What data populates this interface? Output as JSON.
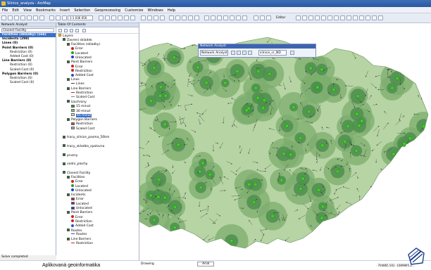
{
  "app": {
    "title": "Silnice_analyza - ArcMap"
  },
  "menu": [
    "File",
    "Edit",
    "View",
    "Bookmarks",
    "Insert",
    "Selection",
    "Geoprocessing",
    "Customize",
    "Windows",
    "Help"
  ],
  "toolbar": {
    "scale": "1:1 036 056",
    "editor_label": "Editor"
  },
  "network_analyst": {
    "title": "Network Analyst",
    "selected": "Closest Facility",
    "items": [
      {
        "label": "Facilities (skladky) (166)",
        "cls": "bold hl"
      },
      {
        "label": "Incidents (298)",
        "cls": "bold"
      },
      {
        "label": "Lines (0)",
        "cls": "bold"
      },
      {
        "label": "Point Barriers (0)",
        "cls": "bold"
      },
      {
        "label": "Restriction (0)",
        "cls": "sub"
      },
      {
        "label": "Added Cost (0)",
        "cls": "sub"
      },
      {
        "label": "Line Barriers (0)",
        "cls": "bold"
      },
      {
        "label": "Restriction (0)",
        "cls": "sub"
      },
      {
        "label": "Scaled Cost (0)",
        "cls": "sub"
      },
      {
        "label": "Polygon Barriers (0)",
        "cls": "bold"
      },
      {
        "label": "Restriction (0)",
        "cls": "sub"
      },
      {
        "label": "Scaled Cost (0)",
        "cls": "sub"
      }
    ],
    "status": "Solve completed"
  },
  "toc": {
    "title": "Table Of Contents",
    "rows": [
      {
        "text": "Layers",
        "indent": 0,
        "kind": "folder"
      },
      {
        "text": "Zavreni skladek",
        "indent": 1,
        "kind": "cb"
      },
      {
        "text": "Facilities (skladky)",
        "indent": 2,
        "kind": "cb"
      },
      {
        "text": "Error",
        "indent": 3,
        "kind": "dot",
        "color": "#d02020"
      },
      {
        "text": "Located",
        "indent": 3,
        "kind": "dot",
        "color": "#20a020"
      },
      {
        "text": "Unlocated",
        "indent": 3,
        "kind": "dot",
        "color": "#2040d0"
      },
      {
        "text": "Point Barriers",
        "indent": 2,
        "kind": "cb"
      },
      {
        "text": "Error",
        "indent": 3,
        "kind": "dot",
        "color": "#d02020"
      },
      {
        "text": "Restriction",
        "indent": 3,
        "kind": "dot",
        "color": "#d02020"
      },
      {
        "text": "Added Cost",
        "indent": 3,
        "kind": "dot",
        "color": "#3050c0"
      },
      {
        "text": "Lines",
        "indent": 2,
        "kind": "cb"
      },
      {
        "text": "Lines",
        "indent": 3,
        "kind": "line",
        "color": "#404040"
      },
      {
        "text": "Line Barriers",
        "indent": 2,
        "kind": "cb"
      },
      {
        "text": "Restriction",
        "indent": 3,
        "kind": "line",
        "color": "#d02020"
      },
      {
        "text": "Scaled Cost",
        "indent": 3,
        "kind": "line",
        "color": "#8080a0"
      },
      {
        "text": "Izochrony",
        "indent": 2,
        "kind": "cb"
      },
      {
        "text": "15 minut",
        "indent": 3,
        "kind": "sw",
        "color": "#3a8a3a"
      },
      {
        "text": "30 minut",
        "indent": 3,
        "kind": "sw",
        "color": "#88b888"
      },
      {
        "text": "45 minut",
        "indent": 3,
        "kind": "swhl",
        "color": "#c8e0c0"
      },
      {
        "text": "Polygon Barriers",
        "indent": 2,
        "kind": "cb"
      },
      {
        "text": "Restriction",
        "indent": 3,
        "kind": "sw",
        "color": "#c84040"
      },
      {
        "text": "Scaled Cost",
        "indent": 3,
        "kind": "sw",
        "color": "#a0a8d8"
      },
      {
        "text": "",
        "indent": 0,
        "kind": "blank"
      },
      {
        "text": "tracy_silnice_pasma_50km",
        "indent": 1,
        "kind": "cb"
      },
      {
        "text": "",
        "indent": 0,
        "kind": "blank"
      },
      {
        "text": "tracy_skladka_spalovna",
        "indent": 1,
        "kind": "cb"
      },
      {
        "text": "",
        "indent": 0,
        "kind": "blank"
      },
      {
        "text": "pruzny",
        "indent": 1,
        "kind": "cb"
      },
      {
        "text": "",
        "indent": 0,
        "kind": "blank"
      },
      {
        "text": "vodni_plochy",
        "indent": 1,
        "kind": "cb"
      },
      {
        "text": "",
        "indent": 0,
        "kind": "blank"
      },
      {
        "text": "Closest Facility",
        "indent": 1,
        "kind": "cb"
      },
      {
        "text": "Facilities",
        "indent": 2,
        "kind": "cb"
      },
      {
        "text": "Error",
        "indent": 3,
        "kind": "dot",
        "color": "#d02020"
      },
      {
        "text": "Located",
        "indent": 3,
        "kind": "dot",
        "color": "#20a020"
      },
      {
        "text": "Unlocated",
        "indent": 3,
        "kind": "dot",
        "color": "#2040d0"
      },
      {
        "text": "Incidents",
        "indent": 2,
        "kind": "cb"
      },
      {
        "text": "Error",
        "indent": 3,
        "kind": "sw",
        "color": "#d02020"
      },
      {
        "text": "Located",
        "indent": 3,
        "kind": "sw",
        "color": "#6030a0"
      },
      {
        "text": "Unlocated",
        "indent": 3,
        "kind": "sw",
        "color": "#2040d0"
      },
      {
        "text": "Point Barriers",
        "indent": 2,
        "kind": "cb"
      },
      {
        "text": "Error",
        "indent": 3,
        "kind": "dot",
        "color": "#d02020"
      },
      {
        "text": "Restriction",
        "indent": 3,
        "kind": "dot",
        "color": "#d02020"
      },
      {
        "text": "Added Cost",
        "indent": 3,
        "kind": "dot",
        "color": "#3050c0"
      },
      {
        "text": "Routes",
        "indent": 2,
        "kind": "cb"
      },
      {
        "text": "Routes",
        "indent": 3,
        "kind": "line",
        "color": "#3050c0"
      },
      {
        "text": "Line Barriers",
        "indent": 2,
        "kind": "cb"
      },
      {
        "text": "Restriction",
        "indent": 3,
        "kind": "line",
        "color": "#d02020"
      }
    ]
  },
  "map_float": {
    "title": "Network Analyst",
    "dropdown": "Network Analyst",
    "layer": "silnice_cr_ND"
  },
  "bottom": {
    "footer": "Aplikovaná geoinformatika",
    "drawing": "Drawing",
    "font": "Arial",
    "coords": "-704865.502  -1089895.2..."
  },
  "colors": {
    "iso_dark": "#4f8f4f",
    "iso_mid": "#7cae6e",
    "iso_light": "#b6d4a4",
    "facility": "#3ecf2a",
    "road": "#3a3a3a"
  }
}
